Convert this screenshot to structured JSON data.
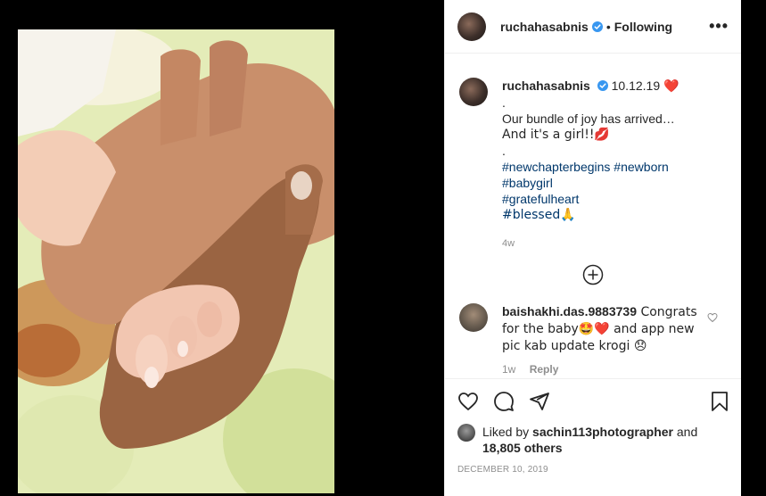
{
  "post": {
    "username": "ruchahasabnis",
    "follow_status": "Following",
    "separator": "•",
    "more_label": "•••"
  },
  "caption": {
    "username": "ruchahasabnis",
    "date_text": "10.12.19",
    "date_emoji": "❤️",
    "lines": [
      ".",
      "Our bundle of joy has arrived…",
      "And it's a girl!!💋",
      "."
    ],
    "hashtags_line1": "#newchapterbegins #newborn",
    "hashtags": [
      "#babygirl",
      "#gratefulheart",
      "#blessed🙏"
    ],
    "age": "4w"
  },
  "comment": {
    "username": "baishakhi.das.9883739",
    "text": " Congrats for the baby🤩❤️ and app new pic kab update krogi 😞",
    "age": "1w",
    "reply_label": "Reply"
  },
  "likes": {
    "prefix": "Liked by ",
    "top_liker": "sachin113photographer",
    "joiner": " and",
    "others": "18,805 others"
  },
  "post_date": "DECEMBER 10, 2019",
  "colors": {
    "hashtag": "#00376b",
    "verified": "#3897f0",
    "muted": "#8e8e8e"
  }
}
